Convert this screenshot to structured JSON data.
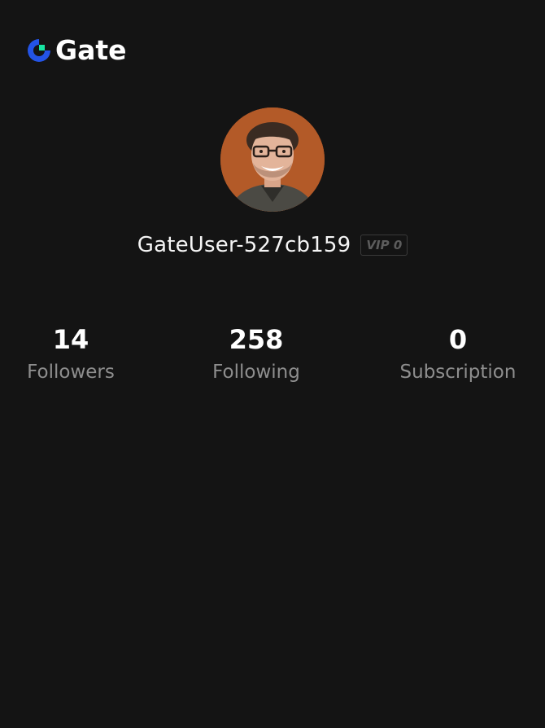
{
  "brand": {
    "name": "Gate",
    "accent_colors": [
      "#2354e6",
      "#17e5a1"
    ]
  },
  "profile": {
    "avatar_icon": "user-avatar-photo",
    "username": "GateUser-527cb159",
    "vip_badge": "VIP 0"
  },
  "stats": [
    {
      "value": "14",
      "label": "Followers"
    },
    {
      "value": "258",
      "label": "Following"
    },
    {
      "value": "0",
      "label": "Subscription"
    }
  ]
}
